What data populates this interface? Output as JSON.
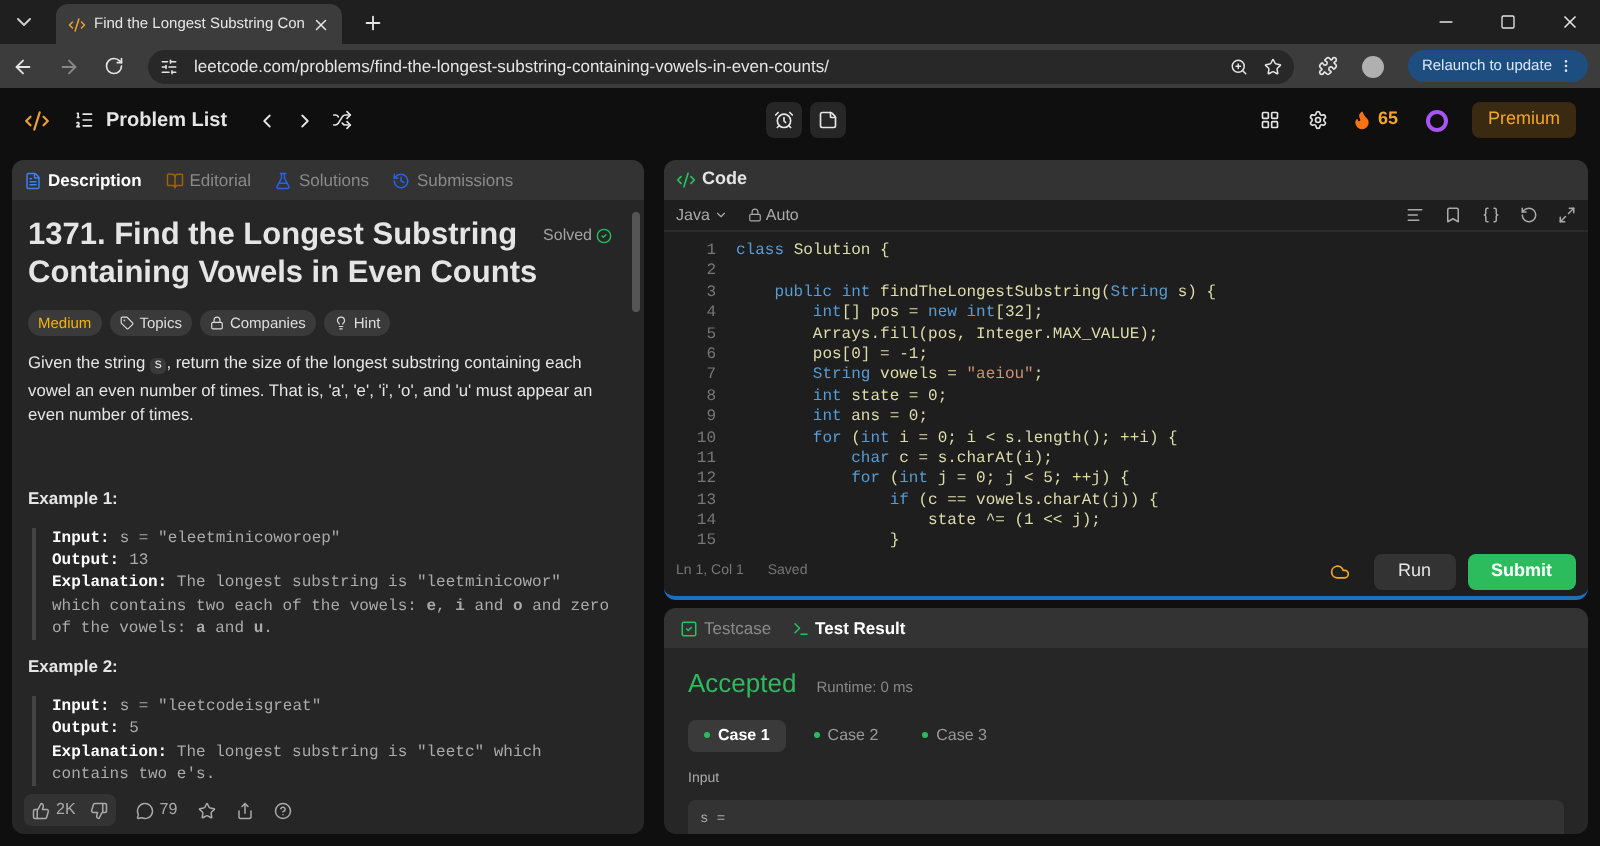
{
  "browser": {
    "tab_title": "Find the Longest Substring Con",
    "url": "leetcode.com/problems/find-the-longest-substring-containing-vowels-in-even-counts/",
    "relaunch": "Relaunch to update"
  },
  "nav": {
    "problem_list": "Problem List",
    "streak": "65",
    "premium": "Premium"
  },
  "left_tabs": [
    {
      "label": "Description",
      "selected": true,
      "color": "#3b82f6"
    },
    {
      "label": "Editorial",
      "selected": false,
      "color": "#a16207"
    },
    {
      "label": "Solutions",
      "selected": false,
      "color": "#2563eb"
    },
    {
      "label": "Submissions",
      "selected": false,
      "color": "#2563eb"
    }
  ],
  "problem": {
    "title": "1371. Find the Longest Substring Containing Vowels in Even Counts",
    "status": "Solved",
    "difficulty": "Medium",
    "tags": [
      "Topics",
      "Companies",
      "Hint"
    ],
    "description": {
      "before": "Given the string ",
      "code": "s",
      "after": ", return the size of the longest substring containing each vowel an even number of times. That is, 'a', 'e', 'i', 'o', and 'u' must appear an even number of times."
    },
    "examples": [
      {
        "heading": "Example 1:",
        "input_label": "Input:",
        "input": "s = \"eleetminicoworoep\"",
        "output_label": "Output:",
        "output": "13",
        "explanation_label": "Explanation:",
        "explanation": "The longest substring is \"leetminicowor\" which contains two each of the vowels: **e**, **i** and **o** and zero of the vowels: **a** and **u**."
      },
      {
        "heading": "Example 2:",
        "input_label": "Input:",
        "input": "s = \"leetcodeisgreat\"",
        "output_label": "Output:",
        "output": "5",
        "explanation_label": "Explanation:",
        "explanation": "The longest substring is \"leetc\" which contains two e's."
      }
    ],
    "likes": "2K",
    "comments": "79"
  },
  "code_panel": {
    "title": "Code",
    "language": "Java",
    "mode": "Auto",
    "lines": [
      {
        "number": "1",
        "text": "class Solution {"
      },
      {
        "number": "2"
      },
      {
        "number": "3",
        "text": "    public int findTheLongestSubstring(String s) {"
      },
      {
        "number": "4",
        "text": "        int[] pos = new int[32];"
      },
      {
        "number": "5",
        "text": "        Arrays.fill(pos, Integer.MAX_VALUE);"
      },
      {
        "number": "6",
        "text": "        pos[0] = -1;"
      },
      {
        "number": "7",
        "text": "        String vowels = \"aeiou\";"
      },
      {
        "number": "8",
        "text": "        int state = 0;"
      },
      {
        "number": "9",
        "text": "        int ans = 0;"
      },
      {
        "number": "10",
        "text": "        for (int i = 0; i < s.length(); ++i) {"
      },
      {
        "number": "11",
        "text": "            char c = s.charAt(i);"
      },
      {
        "number": "12",
        "text": "            for (int j = 0; j < 5; ++j) {"
      },
      {
        "number": "13",
        "text": "                if (c == vowels.charAt(j)) {"
      },
      {
        "number": "14",
        "text": "                    state ^= (1 << j);"
      },
      {
        "number": "15",
        "text": "                }"
      }
    ],
    "cursor": "Ln 1, Col 1",
    "saved": "Saved",
    "run": "Run",
    "submit": "Submit"
  },
  "result_panel": {
    "tabs": [
      {
        "label": "Testcase",
        "selected": false
      },
      {
        "label": "Test Result",
        "selected": true
      }
    ],
    "verdict": "Accepted",
    "runtime": "Runtime: 0 ms",
    "cases": [
      {
        "label": "Case 1",
        "selected": true
      },
      {
        "label": "Case 2",
        "selected": false
      },
      {
        "label": "Case 3",
        "selected": false
      }
    ],
    "input_label": "Input",
    "input_value": "s ="
  }
}
